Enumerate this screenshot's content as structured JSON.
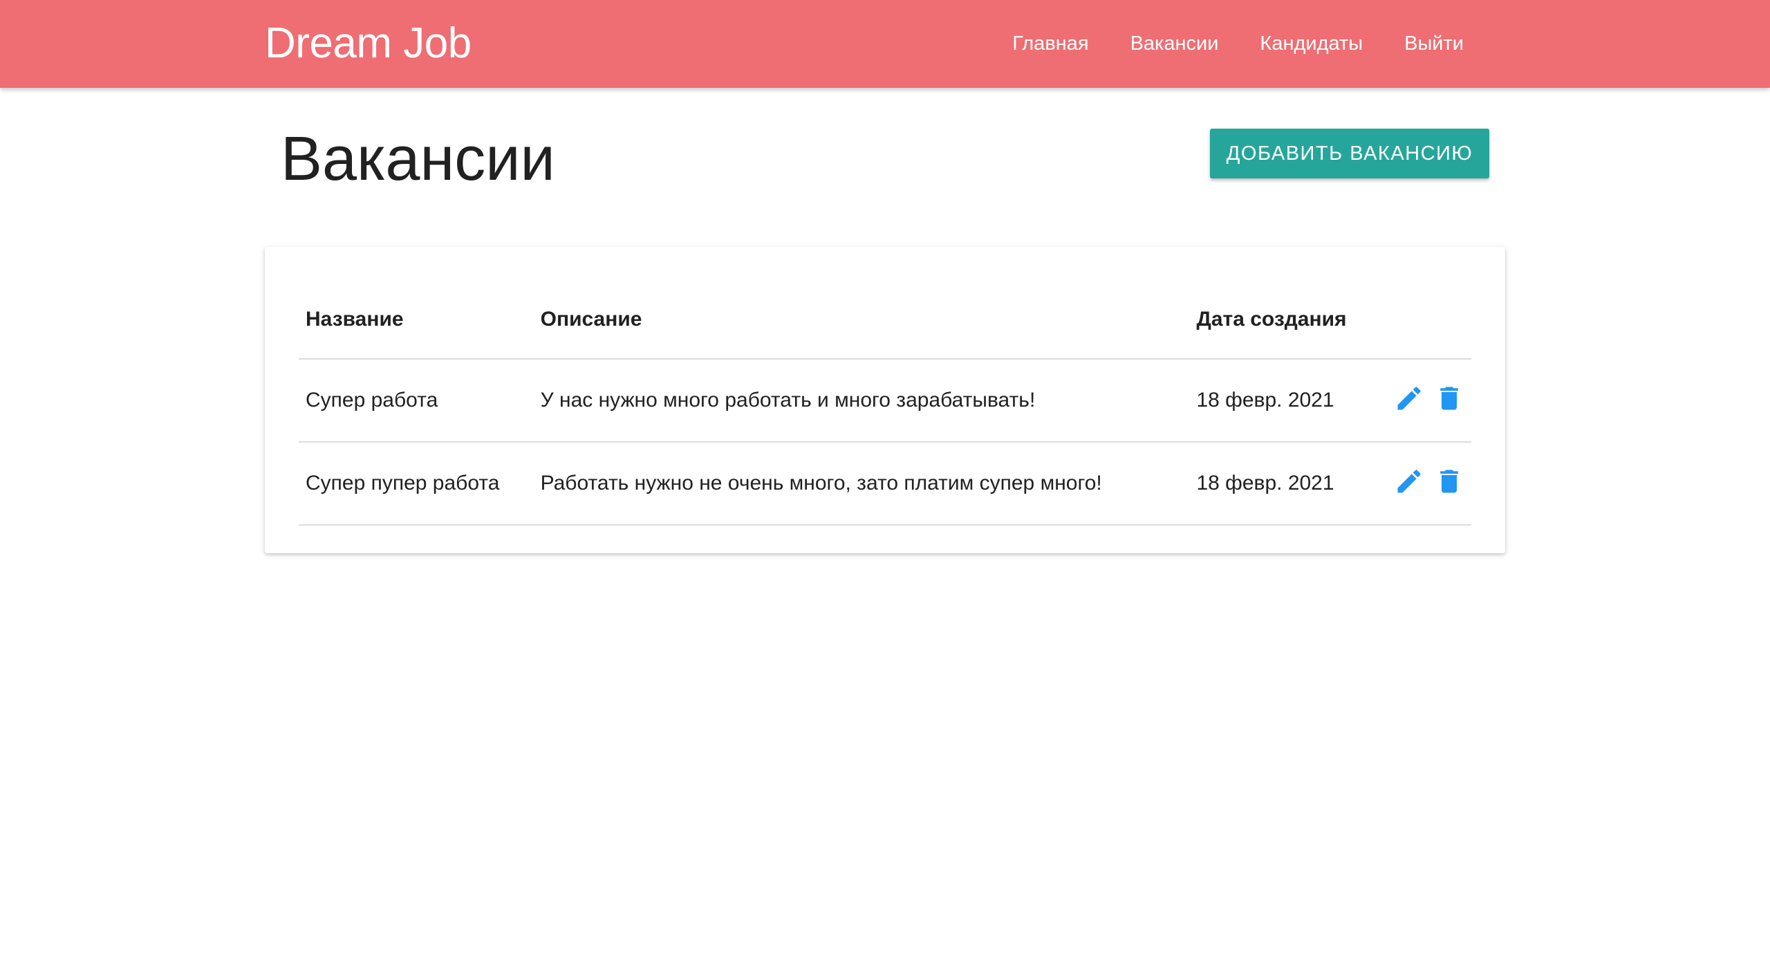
{
  "navbar": {
    "brand": "Dream Job",
    "links": [
      {
        "label": "Главная"
      },
      {
        "label": "Вакансии"
      },
      {
        "label": "Кандидаты"
      },
      {
        "label": "Выйти"
      }
    ],
    "background_color": "#ee6e73"
  },
  "page": {
    "title": "Вакансии",
    "add_button_label": "Добавить вакансию",
    "add_button_color": "#26a69a"
  },
  "table": {
    "headers": {
      "name": "Название",
      "description": "Описание",
      "created": "Дата создания"
    },
    "rows": [
      {
        "name": "Супер работа",
        "description": "У нас нужно много работать и много зарабатывать!",
        "created": "18 февр. 2021",
        "edit_icon": "pencil-icon",
        "delete_icon": "trash-icon"
      },
      {
        "name": "Супер пупер работа",
        "description": "Работать нужно не очень много, зато платим супер много!",
        "created": "18 февр. 2021",
        "edit_icon": "pencil-icon",
        "delete_icon": "trash-icon"
      }
    ],
    "icon_color": "#2196f3"
  }
}
